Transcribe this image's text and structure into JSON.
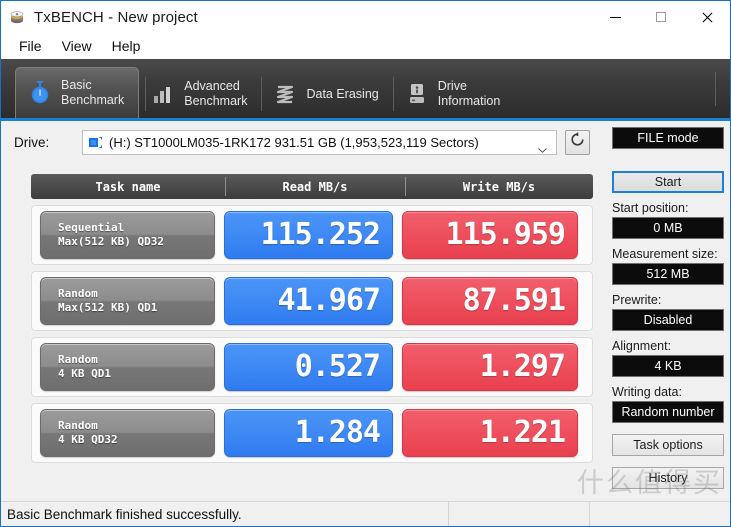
{
  "window": {
    "title": "TxBENCH - New project",
    "app_icon": "drive-stack-icon",
    "minimize_label": "Minimize",
    "maximize_label": "Maximize",
    "close_label": "Close"
  },
  "menu": {
    "items": [
      {
        "label": "File"
      },
      {
        "label": "View"
      },
      {
        "label": "Help"
      }
    ]
  },
  "tabs": [
    {
      "label": "Basic\nBenchmark",
      "icon": "stopwatch-icon",
      "active": true
    },
    {
      "label": "Advanced\nBenchmark",
      "icon": "bar-chart-icon",
      "active": false
    },
    {
      "label": "Data Erasing",
      "icon": "shredder-icon",
      "active": false
    },
    {
      "label": "Drive\nInformation",
      "icon": "drive-info-icon",
      "active": false
    }
  ],
  "drive": {
    "label": "Drive:",
    "selected": "(H:) ST1000LM035-1RK172  931.51 GB (1,953,523,119 Sectors)",
    "icon": "hard-disk-icon",
    "refresh_icon": "refresh-icon"
  },
  "table": {
    "headers": [
      "Task name",
      "Read MB/s",
      "Write MB/s"
    ],
    "rows": [
      {
        "task_line1": "Sequential",
        "task_line2": "Max(512 KB) QD32",
        "read": "115.252",
        "write": "115.959"
      },
      {
        "task_line1": "Random",
        "task_line2": "Max(512 KB) QD1",
        "read": "41.967",
        "write": "87.591"
      },
      {
        "task_line1": "Random",
        "task_line2": "4 KB QD1",
        "read": "0.527",
        "write": "1.297"
      },
      {
        "task_line1": "Random",
        "task_line2": "4 KB QD32",
        "read": "1.284",
        "write": "1.221"
      }
    ]
  },
  "sidebar": {
    "mode_value": "FILE mode",
    "start_label": "Start",
    "start_position_label": "Start position:",
    "start_position_value": "0 MB",
    "measurement_size_label": "Measurement size:",
    "measurement_size_value": "512 MB",
    "prewrite_label": "Prewrite:",
    "prewrite_value": "Disabled",
    "alignment_label": "Alignment:",
    "alignment_value": "4 KB",
    "writing_data_label": "Writing data:",
    "writing_data_value": "Random number",
    "task_options_label": "Task options",
    "history_label": "History"
  },
  "status": {
    "message": "Basic Benchmark finished successfully."
  },
  "watermark": {
    "text": "什么值得买"
  },
  "colors": {
    "read_blue": "#3f89f4",
    "write_red": "#ee4f5d",
    "accent_blue": "#1b7fd4",
    "tabstrip_dark": "#3b3b3b",
    "value_field_black": "#0c0c0c"
  }
}
